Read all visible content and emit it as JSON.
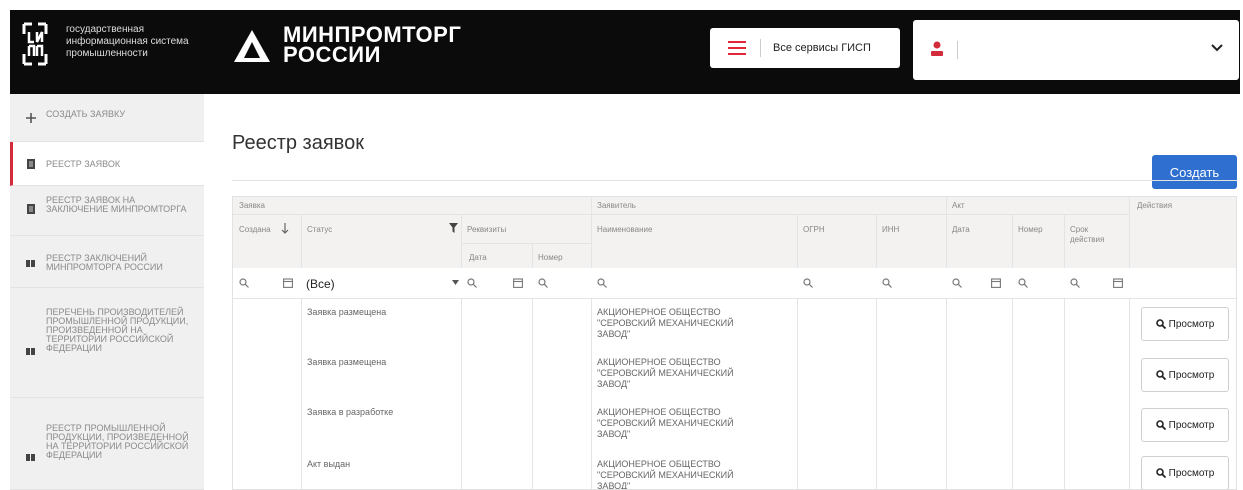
{
  "header": {
    "gisp_logo_text": [
      "государственная",
      "информационная система",
      "промышленности"
    ],
    "ministry_title": [
      "МИНПРОМТОРГ",
      "РОССИИ"
    ],
    "services_label": "Все сервисы ГИСП"
  },
  "sidebar": {
    "items": [
      {
        "label": "СОЗДАТЬ ЗАЯВКУ",
        "icon": "plus-icon",
        "active": false
      },
      {
        "label": "РЕЕСТР ЗАЯВОК",
        "icon": "document-icon",
        "active": true
      },
      {
        "label": "РЕЕСТР ЗАЯВОК НА ЗАКЛЮЧЕНИЕ МИНПРОМТОРГА",
        "icon": "document-icon",
        "active": false
      },
      {
        "label": "РЕЕСТР ЗАКЛЮЧЕНИЙ МИНПРОМТОРГА РОССИИ",
        "icon": "registry-icon",
        "active": false
      },
      {
        "label": "ПЕРЕЧЕНЬ ПРОИЗВОДИТЕЛЕЙ ПРОМЫШЛЕННОЙ ПРОДУКЦИИ, ПРОИЗВЕДЕННОЙ НА ТЕРРИТОРИИ РОССИЙСКОЙ ФЕДЕРАЦИИ",
        "icon": "registry-icon",
        "active": false
      },
      {
        "label": "РЕЕСТР ПРОМЫШЛЕННОЙ ПРОДУКЦИИ, ПРОИЗВЕДЕННОЙ НА ТЕРРИТОРИИ РОССИЙСКОЙ ФЕДЕРАЦИИ",
        "icon": "registry-icon",
        "active": false
      }
    ]
  },
  "main": {
    "title": "Реестр заявок",
    "create_label": "Создать"
  },
  "table": {
    "groups": {
      "zayavka": "Заявка",
      "zayavitel": "Заявитель",
      "akt": "Акт",
      "actions": "Действия"
    },
    "columns": {
      "created": "Создана",
      "status": "Статус",
      "requisites": "Реквизиты",
      "date": "Дата",
      "number": "Номер",
      "name": "Наименование",
      "ogrn": "ОГРН",
      "inn": "ИНН",
      "akt_date": "Дата",
      "akt_number": "Номер",
      "validity": "Срок действия"
    },
    "status_filter_value": "(Все)",
    "view_label": "Просмотр",
    "rows": [
      {
        "status": "Заявка размещена",
        "name": "АКЦИОНЕРНОЕ ОБЩЕСТВО \"СЕРОВСКИЙ МЕХАНИЧЕСКИЙ ЗАВОД\""
      },
      {
        "status": "Заявка размещена",
        "name": "АКЦИОНЕРНОЕ ОБЩЕСТВО \"СЕРОВСКИЙ МЕХАНИЧЕСКИЙ ЗАВОД\""
      },
      {
        "status": "Заявка в разработке",
        "name": "АКЦИОНЕРНОЕ ОБЩЕСТВО \"СЕРОВСКИЙ МЕХАНИЧЕСКИЙ ЗАВОД\""
      },
      {
        "status": "Акт выдан",
        "name": "АКЦИОНЕРНОЕ ОБЩЕСТВО \"СЕРОВСКИЙ МЕХАНИЧЕСКИЙ ЗАВОД\""
      }
    ]
  },
  "colors": {
    "header_bg": "#0b0b0b",
    "accent_blue": "#2f6fd0",
    "accent_red": "#d22b3c",
    "sidebar_bg": "#f0f0f0"
  }
}
